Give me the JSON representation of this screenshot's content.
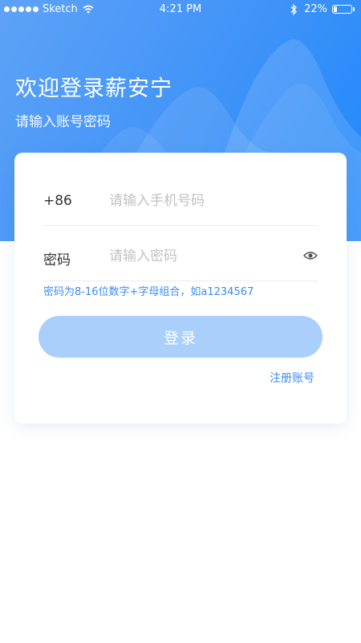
{
  "status_bar": {
    "carrier": "Sketch",
    "time": "4:21 PM",
    "battery_percent": "22%",
    "battery_level": 0.22
  },
  "header": {
    "title": "欢迎登录薪安宁",
    "subtitle": "请输入账号密码"
  },
  "form": {
    "phone_prefix": "+86",
    "phone_placeholder": "请输入手机号码",
    "password_label": "密码",
    "password_placeholder": "请输入密码",
    "password_hint": "密码为8-16位数字+字母组合，如a1234567",
    "login_label": "登录",
    "register_label": "注册账号"
  },
  "colors": {
    "brand_blue": "#3f93f8",
    "login_button_disabled": "#a9cffa",
    "link_blue": "#3b8cf0"
  }
}
